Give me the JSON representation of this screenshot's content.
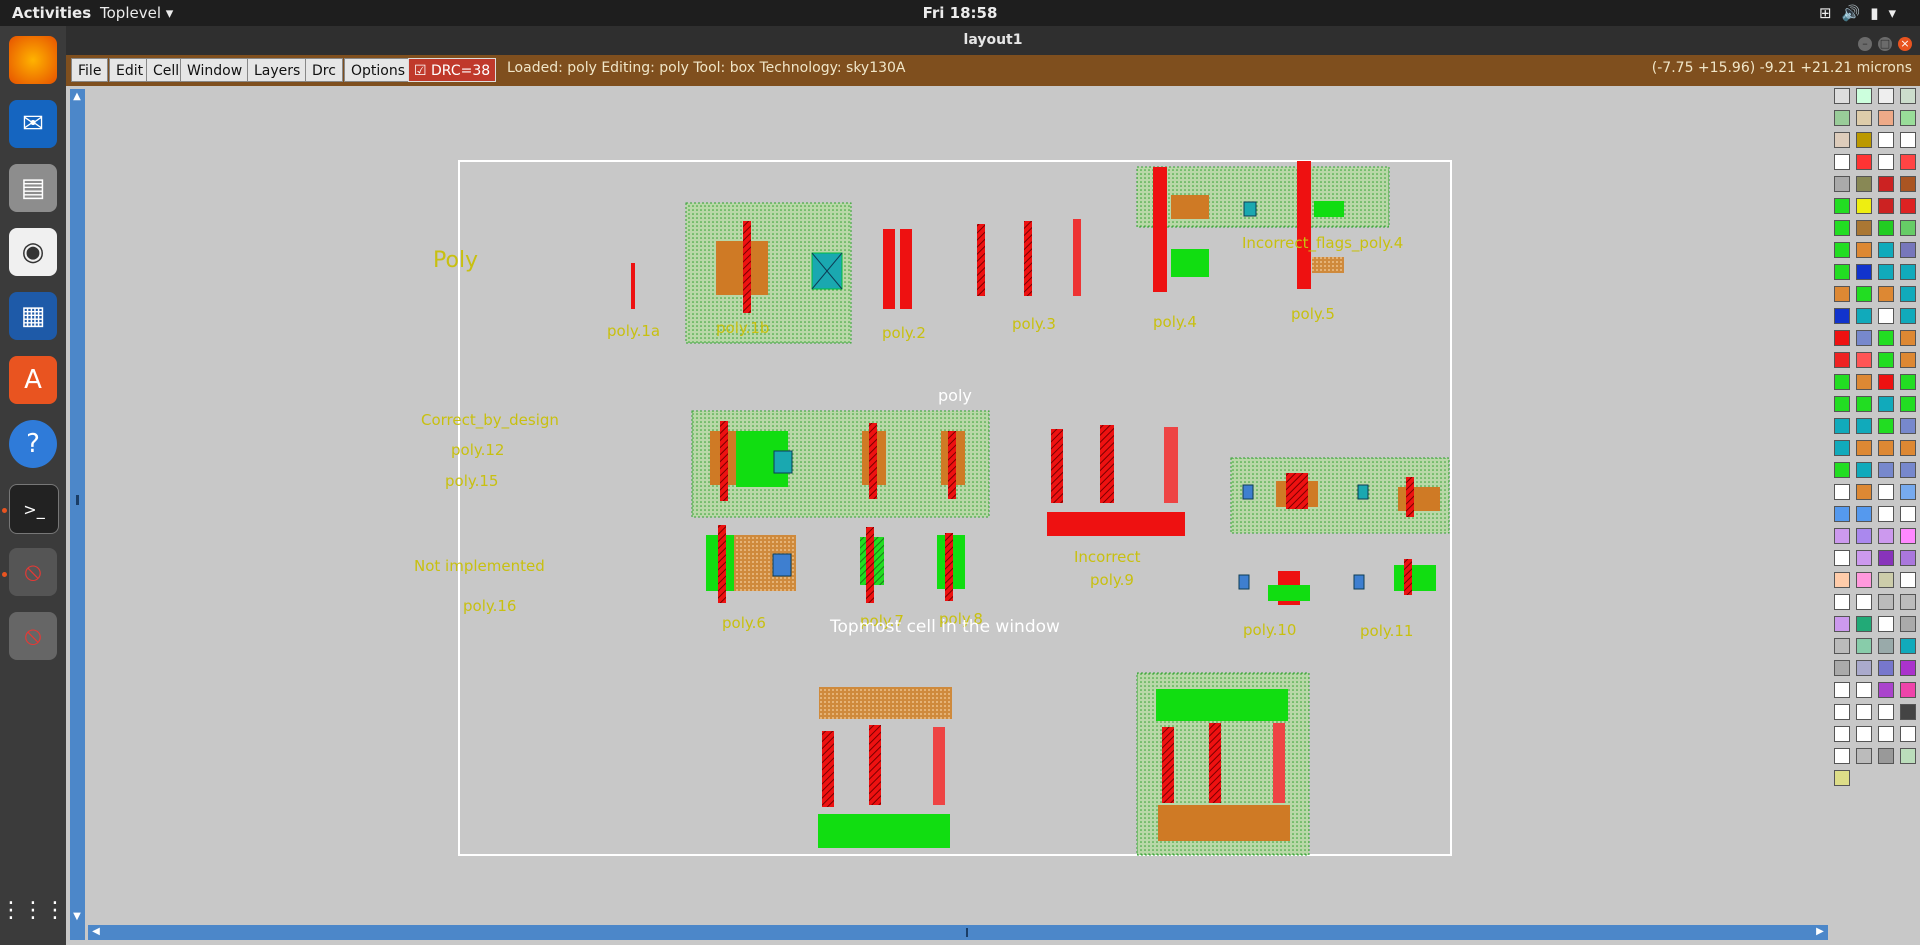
{
  "topbar": {
    "activities": "Activities",
    "app": "Toplevel",
    "clock": "Fri 18:58"
  },
  "dock": [
    "firefox",
    "thunderbird",
    "files",
    "rhythmbox",
    "writer",
    "software",
    "help",
    "terminal",
    "magic",
    "magic"
  ],
  "window": {
    "title": "layout1"
  },
  "menu": {
    "file": "File",
    "edit": "Edit",
    "cell": "Cell",
    "window": "Window",
    "layers": "Layers",
    "drc": "Drc",
    "options": "Options"
  },
  "drc_label": "DRC=38",
  "status": "Loaded: poly Editing: poly Tool: box  Technology: sky130A",
  "coords": "(-7.75 +15.96) -9.21 +21.21 microns",
  "labels": {
    "poly_title": "Poly",
    "poly1a": "poly.1a",
    "poly1b": "poly.1b",
    "poly2": "poly.2",
    "poly3": "poly.3",
    "poly4": "poly.4",
    "poly5": "poly.5",
    "incorrect_flags": "Incorrect_flags_poly.4",
    "center_poly": "poly",
    "correct_by_design": "Correct_by_design",
    "poly12": "poly.12",
    "poly15": "poly.15",
    "not_implemented": "Not implemented",
    "poly16": "poly.16",
    "incorrect": "Incorrect",
    "poly9": "poly.9",
    "poly6": "poly.6",
    "poly7": "poly.7",
    "poly8": "poly.8",
    "poly10": "poly.10",
    "poly11": "poly.11",
    "topmost": "Topmost cell in the window"
  }
}
